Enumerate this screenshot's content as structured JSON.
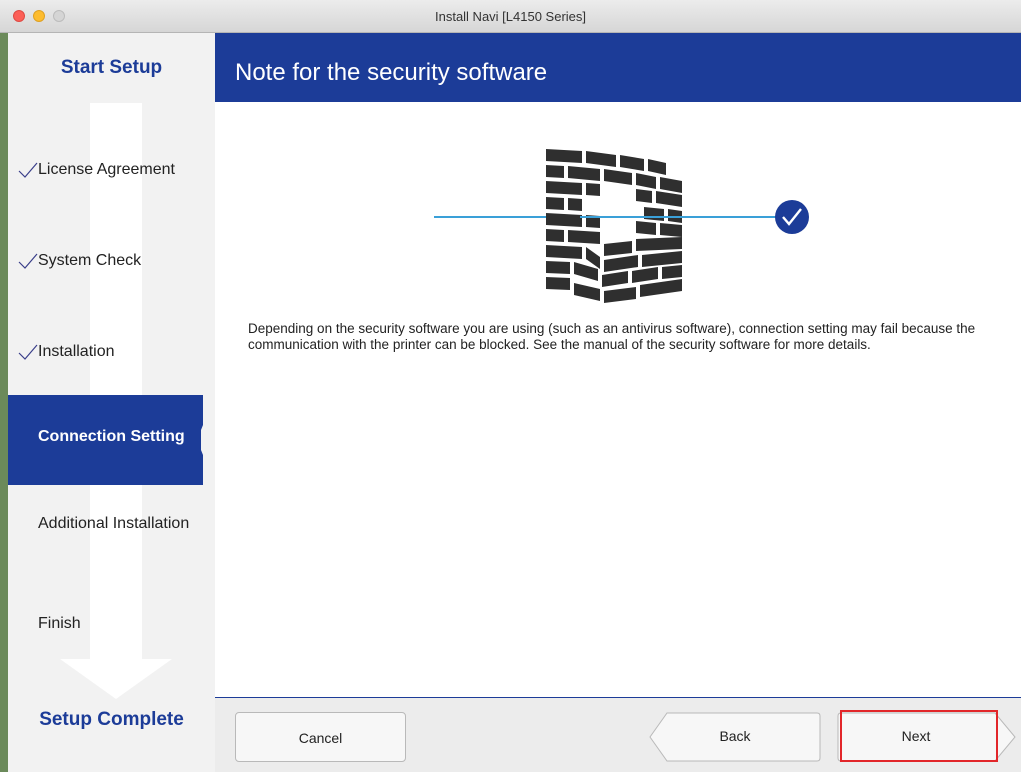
{
  "window": {
    "title": "Install Navi [L4150 Series]"
  },
  "sidebar": {
    "start_heading": "Start Setup",
    "end_heading": "Setup Complete",
    "steps": [
      {
        "label": "License Agreement",
        "done": true
      },
      {
        "label": "System Check",
        "done": true
      },
      {
        "label": "Installation",
        "done": true
      },
      {
        "label": "Connection Setting",
        "active": true
      },
      {
        "label": "Additional Installation",
        "done": false
      },
      {
        "label": "Finish",
        "done": false
      }
    ]
  },
  "page": {
    "title": "Note for the security software",
    "description": "Depending on the security software you are using (such as an antivirus software), connection setting may fail because the communication with the printer can be blocked. See the manual of the security software for more details."
  },
  "footer": {
    "cancel_label": "Cancel",
    "back_label": "Back",
    "next_label": "Next"
  },
  "colors": {
    "accent": "#1c3c98",
    "link_line": "#3aa0d8",
    "highlight": "#e2262a",
    "wall": "#2f2f2f"
  },
  "icons": [
    "check-icon",
    "firewall-icon",
    "check-circle-icon",
    "down-arrow-icon"
  ]
}
